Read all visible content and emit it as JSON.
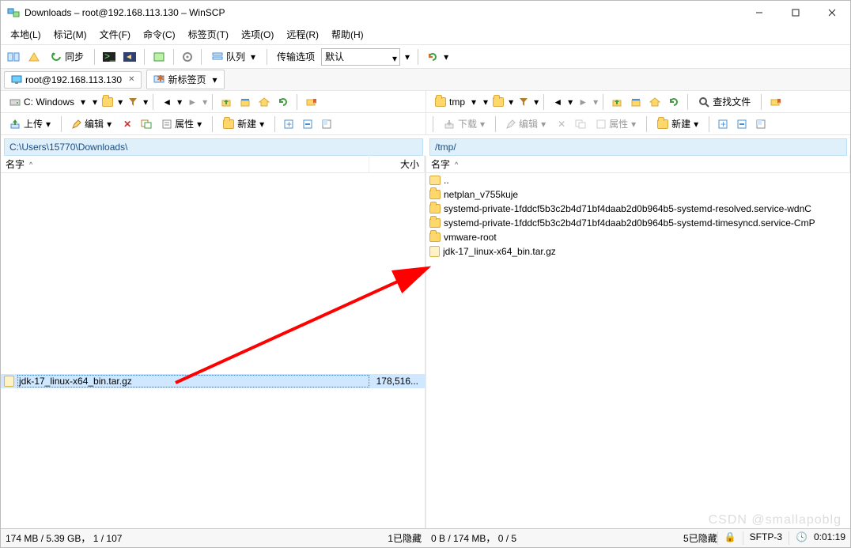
{
  "window": {
    "title": "Downloads – root@192.168.113.130 – WinSCP"
  },
  "menu": {
    "items": [
      "本地(L)",
      "标记(M)",
      "文件(F)",
      "命令(C)",
      "标签页(T)",
      "选项(O)",
      "远程(R)",
      "帮助(H)"
    ]
  },
  "toolbar1": {
    "sync_label": "同步",
    "queue_label": "队列",
    "transfer_options_label": "传输选项",
    "transfer_mode": "默认"
  },
  "sessions": {
    "active": {
      "label": "root@192.168.113.130"
    },
    "new_tab": {
      "label": "新标签页"
    }
  },
  "local": {
    "drive_label": "C: Windows",
    "path": "C:\\Users\\15770\\Downloads\\",
    "upload_label": "上传",
    "edit_label": "编辑",
    "props_label": "属性",
    "new_label": "新建",
    "columns": {
      "name": "名字",
      "size": "大小"
    },
    "files": [
      {
        "name": "jdk-17_linux-x64_bin.tar.gz",
        "size": "178,516...",
        "type": "tgz",
        "selected": true
      }
    ],
    "status": {
      "summary": "174 MB / 5.39 GB，  1 / 107",
      "hidden": "1已隐藏"
    }
  },
  "remote": {
    "dir_label": "tmp",
    "path": "/tmp/",
    "download_label": "下载",
    "edit_label": "编辑",
    "props_label": "属性",
    "new_label": "新建",
    "findfiles_label": "查找文件",
    "columns": {
      "name": "名字"
    },
    "files": [
      {
        "name": "..",
        "type": "up"
      },
      {
        "name": "netplan_v755kuje",
        "type": "folder"
      },
      {
        "name": "systemd-private-1fddcf5b3c2b4d71bf4daab2d0b964b5-systemd-resolved.service-wdnC",
        "type": "folder"
      },
      {
        "name": "systemd-private-1fddcf5b3c2b4d71bf4daab2d0b964b5-systemd-timesyncd.service-CmP",
        "type": "folder"
      },
      {
        "name": "vmware-root",
        "type": "folder"
      },
      {
        "name": "jdk-17_linux-x64_bin.tar.gz",
        "type": "tgz"
      }
    ],
    "status": {
      "summary": "0 B / 174 MB，  0 / 5",
      "hidden": "5已隐藏"
    }
  },
  "footer": {
    "protocol": "SFTP-3",
    "time": "0:01:19"
  },
  "watermark": "CSDN @smallapoblg"
}
